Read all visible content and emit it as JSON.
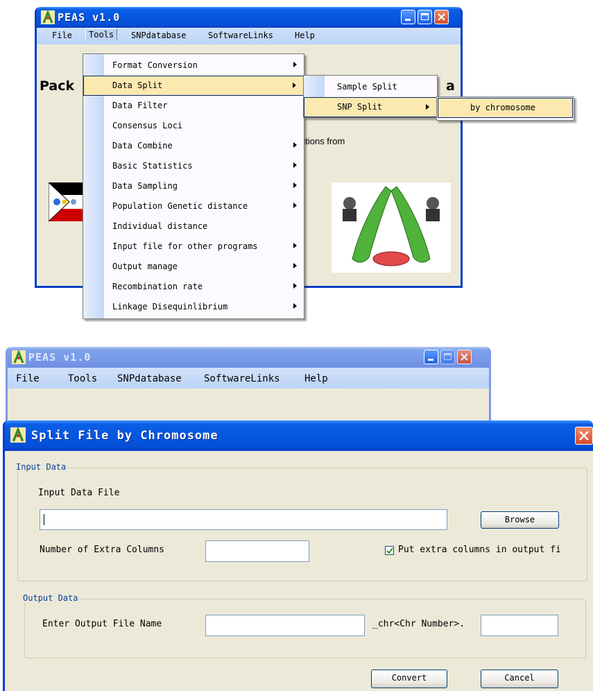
{
  "top_window": {
    "title": "PEAS v1.0",
    "menu": [
      "File",
      "Tools",
      "SNPdatabase",
      "SoftwareLinks",
      "Help"
    ],
    "content_heading_left": "Pack",
    "content_heading_right": "a",
    "content_text_fragment": "utions from"
  },
  "tools_menu": [
    {
      "label": "Format Conversion",
      "submenu": true
    },
    {
      "label": "Data Split",
      "submenu": true,
      "highlighted": true
    },
    {
      "label": "Data Filter",
      "submenu": false
    },
    {
      "label": "Consensus Loci",
      "submenu": false
    },
    {
      "label": "Data Combine",
      "submenu": true
    },
    {
      "label": "Basic Statistics",
      "submenu": true
    },
    {
      "label": "Data Sampling",
      "submenu": true
    },
    {
      "label": "Population Genetic distance",
      "submenu": true
    },
    {
      "label": "Individual distance",
      "submenu": false
    },
    {
      "label": "Input file for other programs",
      "submenu": true
    },
    {
      "label": "Output manage",
      "submenu": true
    },
    {
      "label": "Recombination rate",
      "submenu": true
    },
    {
      "label": "Linkage Disequinlibrium",
      "submenu": true
    }
  ],
  "data_split_submenu": [
    {
      "label": "Sample Split",
      "submenu": false
    },
    {
      "label": "SNP Split",
      "submenu": true,
      "highlighted": true
    }
  ],
  "snp_split_submenu": [
    {
      "label": "by chromosome",
      "highlighted": true
    }
  ],
  "bottom_window": {
    "title": "PEAS v1.0",
    "menu": [
      "File",
      "Tools",
      "SNPdatabase",
      "SoftwareLinks",
      "Help"
    ]
  },
  "dialog": {
    "title": "Split File by Chromosome",
    "input_group": "Input Data",
    "input_file_label": "Input Data File",
    "input_file_value": "",
    "browse_label": "Browse",
    "extra_columns_label": "Number of Extra Columns",
    "extra_columns_value": "",
    "put_extra_label": "Put extra columns in output fi",
    "put_extra_checked": true,
    "output_group": "Output Data",
    "output_name_label": "Enter Output File Name",
    "output_name_value": "",
    "suffix_label": "_chr<Chr Number>.",
    "extension_value": "",
    "convert_label": "Convert",
    "cancel_label": "Cancel"
  },
  "colors": {
    "title_active": "#0556e0",
    "menu_highlight": "#fbe9b0",
    "legend_text": "#0b3d9c",
    "menubar": "#c4d9f8"
  }
}
